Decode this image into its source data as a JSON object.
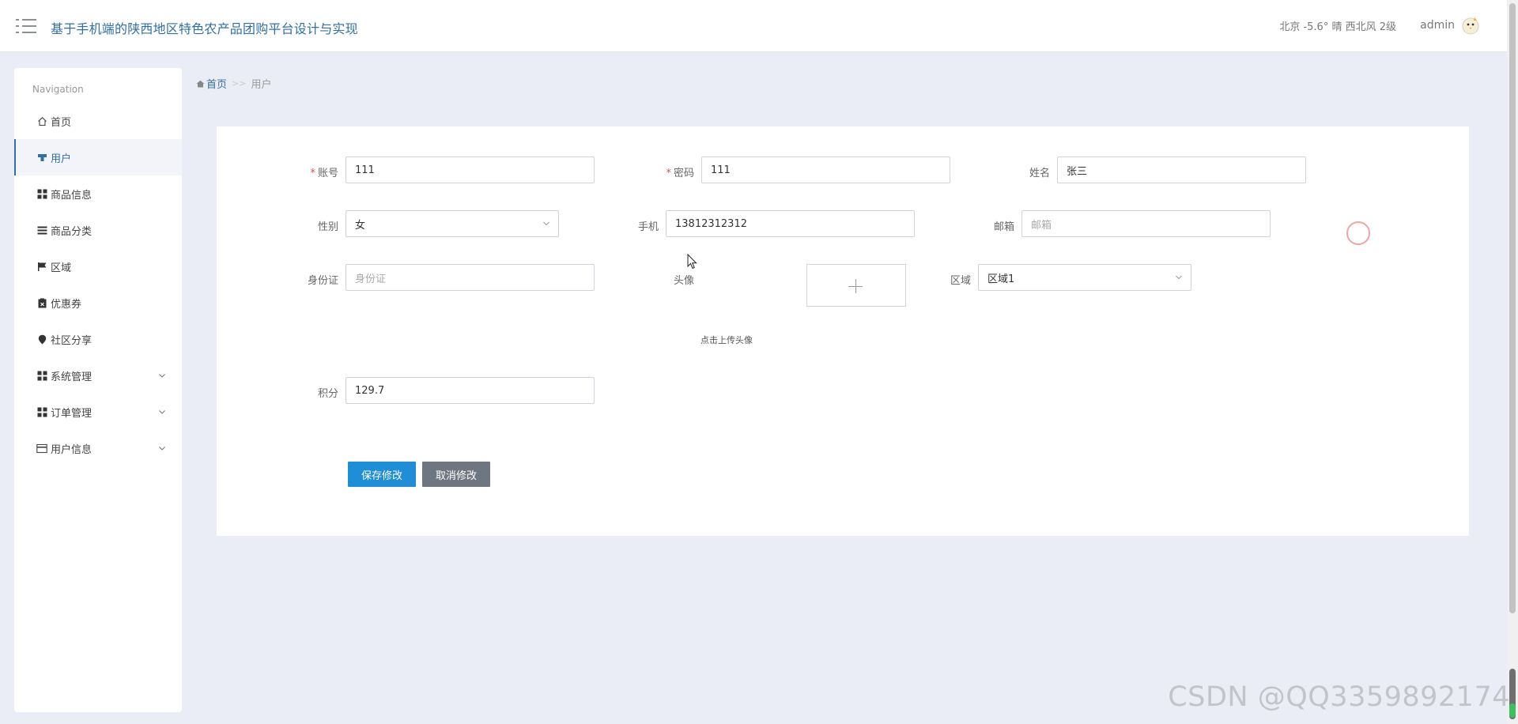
{
  "header": {
    "app_title": "基于手机端的陕西地区特色农产品团购平台设计与实现",
    "weather": "北京  -5.6°  晴  西北风  2级",
    "user": "admin"
  },
  "sidebar": {
    "heading": "Navigation",
    "items": [
      {
        "label": "首页",
        "icon": "home-icon"
      },
      {
        "label": "用户",
        "icon": "user-icon"
      },
      {
        "label": "商品信息",
        "icon": "grid-icon"
      },
      {
        "label": "商品分类",
        "icon": "list-icon"
      },
      {
        "label": "区域",
        "icon": "flag-icon"
      },
      {
        "label": "优惠券",
        "icon": "clipboard-icon"
      },
      {
        "label": "社区分享",
        "icon": "map-pin-icon"
      },
      {
        "label": "系统管理",
        "icon": "grid-icon"
      },
      {
        "label": "订单管理",
        "icon": "grid-icon"
      },
      {
        "label": "用户信息",
        "icon": "card-icon"
      }
    ]
  },
  "breadcrumb": {
    "home": "首页",
    "separator": ">>",
    "current": "用户"
  },
  "form": {
    "account": {
      "label": "账号",
      "value": "111"
    },
    "password": {
      "label": "密码",
      "value": "111"
    },
    "name": {
      "label": "姓名",
      "value": "张三"
    },
    "gender": {
      "label": "性别",
      "value": "女"
    },
    "phone": {
      "label": "手机",
      "value": "13812312312"
    },
    "email": {
      "label": "邮箱",
      "placeholder": "邮箱"
    },
    "id_card": {
      "label": "身份证",
      "placeholder": "身份证"
    },
    "avatar": {
      "label": "头像",
      "hint": "点击上传头像"
    },
    "region": {
      "label": "区域",
      "value": "区域1"
    },
    "points": {
      "label": "积分",
      "value": "129.7"
    },
    "required_mark": "*"
  },
  "buttons": {
    "save": "保存修改",
    "cancel": "取消修改"
  },
  "watermark": "CSDN @QQ3359892174",
  "colors": {
    "accent": "#2f6fa5",
    "save_button": "#1f8ed6",
    "cancel_button": "#6e7781",
    "background": "#eaedf5"
  }
}
